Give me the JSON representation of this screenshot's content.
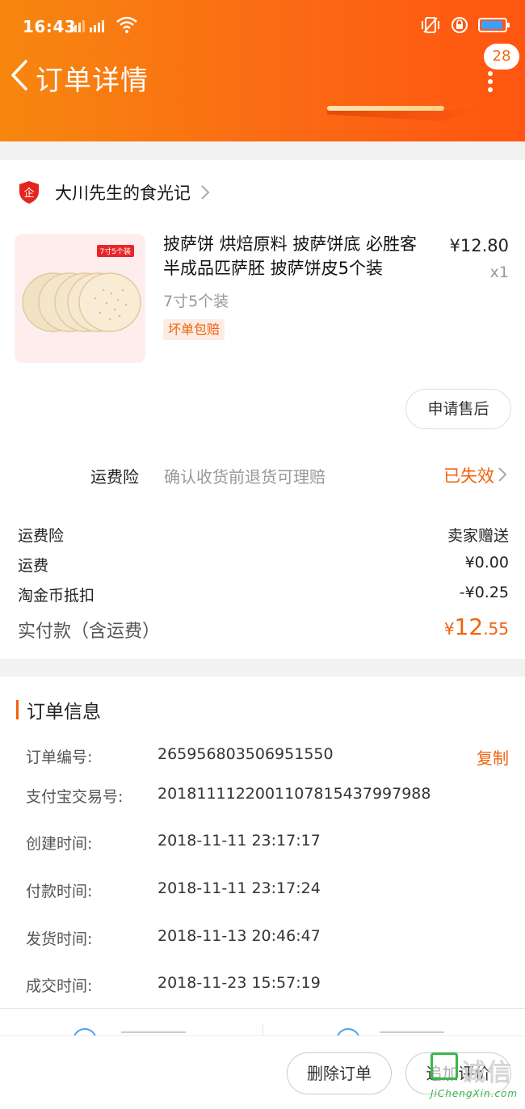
{
  "status_bar": {
    "time": "16:43",
    "network": "4G"
  },
  "header": {
    "title": "订单详情",
    "message_count": "28"
  },
  "shop": {
    "name": "大川先生的食光记",
    "icon_text": "企"
  },
  "product": {
    "title": "披萨饼 烘焙原料 披萨饼底 必胜客半成品匹萨胚 披萨饼皮5个装",
    "spec": "7寸5个装",
    "badge": "坏单包赔",
    "price": "¥12.80",
    "quantity": "x1",
    "image_tag": "7寸5个装"
  },
  "after_sale_button": "申请售后",
  "insurance": {
    "label": "运费险",
    "description": "确认收货前退货可理赔",
    "status": "已失效"
  },
  "fees": [
    {
      "label": "运费险",
      "value": "卖家赠送"
    },
    {
      "label": "运费",
      "value": "¥0.00"
    },
    {
      "label": "淘金币抵扣",
      "value": "-¥0.25"
    }
  ],
  "total": {
    "label": "实付款（含运费）",
    "currency": "¥",
    "integer": "12",
    "decimal": ".55"
  },
  "order_info": {
    "title": "订单信息",
    "copy_label": "复制",
    "rows": [
      {
        "label": "订单编号:",
        "value": "265956803506951550"
      },
      {
        "label": "支付宝交易号:",
        "value": "2018111122001107815437997988"
      },
      {
        "label": "创建时间:",
        "value": "2018-11-11 23:17:17"
      },
      {
        "label": "付款时间:",
        "value": "2018-11-11 23:17:24"
      },
      {
        "label": "发货时间:",
        "value": "2018-11-13 20:46:47"
      },
      {
        "label": "成交时间:",
        "value": "2018-11-23 15:57:19"
      }
    ]
  },
  "bottom_bar": {
    "delete_label": "删除订单",
    "review_label": "追加评价"
  },
  "watermark": {
    "text": "诚信",
    "sub": "JiChengXin.com"
  },
  "colors": {
    "accent": "#f1620f",
    "header_start": "#f7870f",
    "header_end": "#ff5510"
  }
}
